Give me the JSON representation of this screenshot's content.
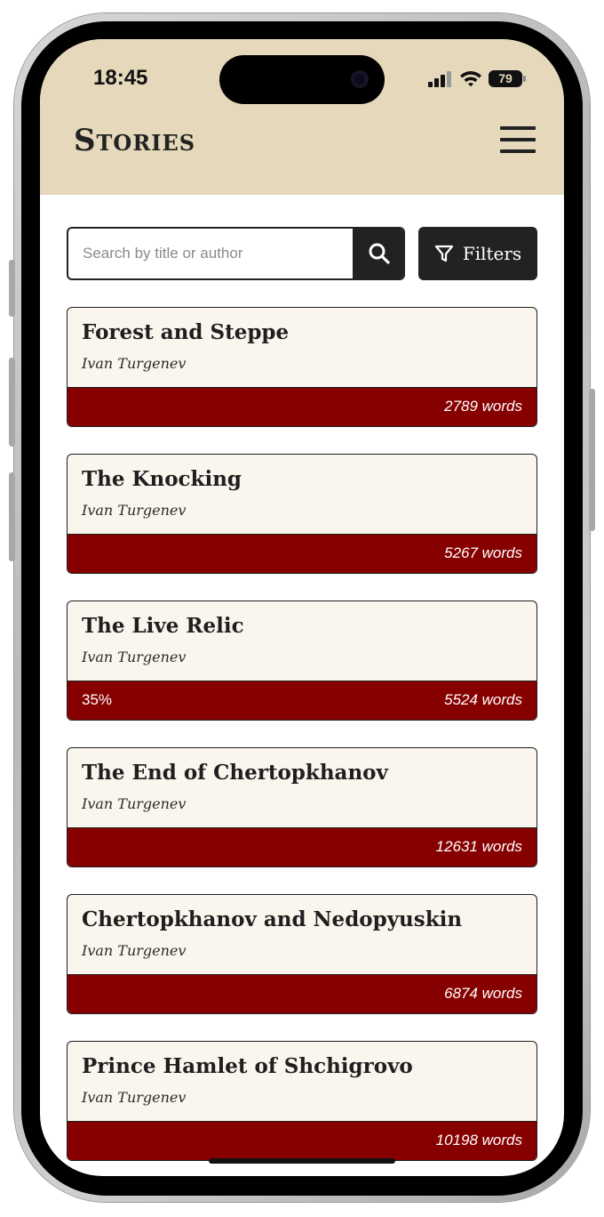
{
  "status_bar": {
    "time": "18:45",
    "battery": "79"
  },
  "header": {
    "title": "Stories",
    "menu_icon": "hamburger-menu-icon"
  },
  "search": {
    "placeholder": "Search by title or author",
    "value": "",
    "button_icon": "search-icon"
  },
  "filters": {
    "label": "Filters",
    "icon": "filter-funnel-icon"
  },
  "colors": {
    "header_bg": "#e5d8bb",
    "card_bg": "#faf6ee",
    "card_bar": "#870000",
    "dark": "#222222"
  },
  "stories": [
    {
      "title": "Forest and Steppe",
      "author": "Ivan Turgenev",
      "progress": "",
      "words": "2789 words"
    },
    {
      "title": "The Knocking",
      "author": "Ivan Turgenev",
      "progress": "",
      "words": "5267 words"
    },
    {
      "title": "The Live Relic",
      "author": "Ivan Turgenev",
      "progress": "35%",
      "words": "5524 words"
    },
    {
      "title": "The End of Chertopkhanov",
      "author": "Ivan Turgenev",
      "progress": "",
      "words": "12631 words"
    },
    {
      "title": "Chertopkhanov and Nedopyuskin",
      "author": "Ivan Turgenev",
      "progress": "",
      "words": "6874 words"
    },
    {
      "title": "Prince Hamlet of Shchigrovo",
      "author": "Ivan Turgenev",
      "progress": "",
      "words": "10198 words"
    }
  ]
}
